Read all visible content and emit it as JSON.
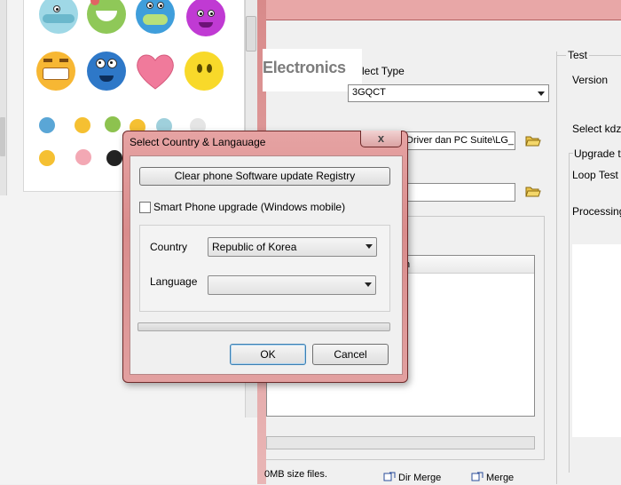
{
  "app": {
    "brand_logo": "Electronics",
    "select_type_label": "lect Type",
    "select_type_value": "3GQCT",
    "path_value": "Driver dan PC Suite\\LG_I",
    "list_header_partial": "h",
    "note_text": "0MB size files.",
    "dir_merge_label": "Dir Merge",
    "merge_label": "Merge",
    "test_group_label": "Test",
    "version_label": "Version",
    "select_kdz_label": "Select kdz f",
    "upgrade_group_label": "Upgrade te",
    "loop_test_label": "Loop Test c",
    "processing_label": "Processing"
  },
  "dialog": {
    "title": "Select Country & Langauage",
    "close_glyph": "x",
    "clear_registry_label": "Clear phone Software update Registry",
    "smart_phone_label": "Smart Phone upgrade (Windows mobile)",
    "smart_phone_checked": false,
    "country_label": "Country",
    "country_value": "Republic of Korea",
    "language_label": "Language",
    "language_value": "",
    "ok_label": "OK",
    "cancel_label": "Cancel"
  },
  "emoticons": {
    "large": [
      "elephant-emoticon",
      "frog-emoticon",
      "blue-bird-emoticon",
      "purple-emoticon",
      "grin-emoticon",
      "blue-goggle-emoticon",
      "heart-emoticon",
      "yellow-emoticon"
    ],
    "small": [
      "emo-1",
      "emo-2",
      "emo-3",
      "emo-4",
      "emo-5",
      "emo-6",
      "emo-7",
      "emo-8",
      "emo-9",
      "emo-10"
    ]
  },
  "colors": {
    "dialog_frame": "#d98c8c",
    "title_bar": "#e8a7a7",
    "ok_focus": "#3c7fb1"
  }
}
